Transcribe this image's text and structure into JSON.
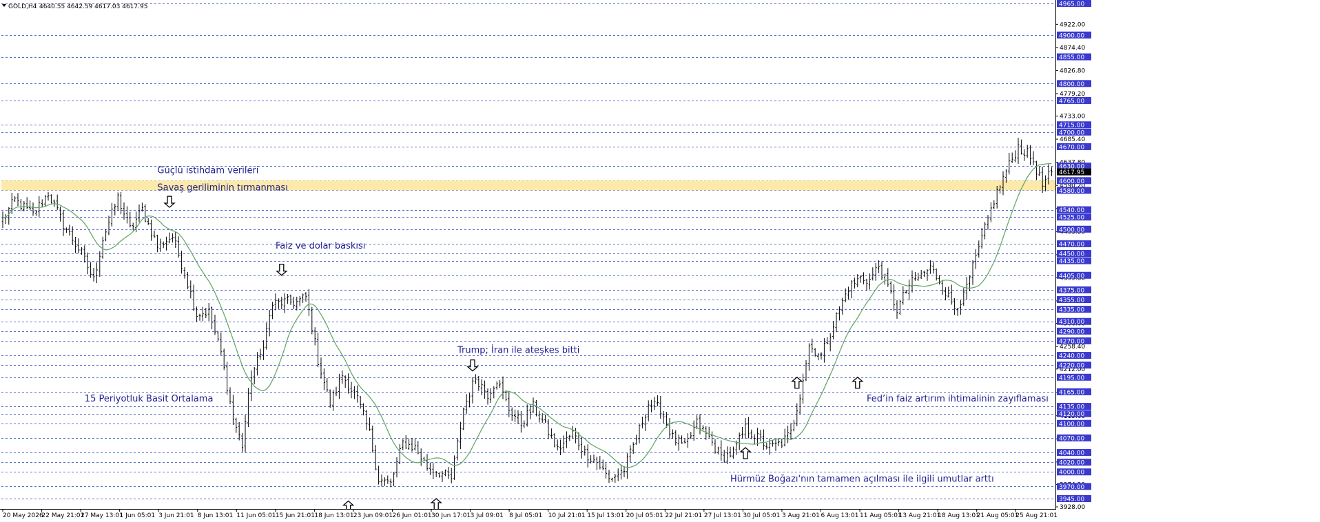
{
  "header": {
    "symbol": "GOLD,H4",
    "ohlc": "4640.55 4642.59 4617.03 4617.95"
  },
  "colors": {
    "background": "#ffffff",
    "grid": "#1f3fbf",
    "candle": "#000000",
    "ma_line": "#6aa86a",
    "highlight_band": "#fde9a8",
    "tag_bg": "#3a3ad0",
    "tag_current": "#000000",
    "annotation_text": "#1f1f8f"
  },
  "icons": {
    "arrow_down": "hollow-arrow-down-icon",
    "arrow_up": "hollow-arrow-up-icon",
    "symbol_menu": "triangle-down-icon"
  },
  "chart_data": {
    "type": "candlestick",
    "indicator": "15 Periyotluk Basit Ortalama",
    "ylim": [
      3928.0,
      4965.0
    ],
    "current_price": 4617.95,
    "highlight_zone": [
      4580.0,
      4600.0
    ],
    "price_axis": {
      "tagged": [
        4965.0,
        4900.0,
        4855.0,
        4800.0,
        4765.0,
        4715.0,
        4700.0,
        4670.0,
        4630.0,
        4600.0,
        4580.0,
        4540.0,
        4525.0,
        4500.0,
        4470.0,
        4450.0,
        4435.0,
        4405.0,
        4375.0,
        4355.0,
        4335.0,
        4310.0,
        4290.0,
        4270.0,
        4240.0,
        4220.0,
        4195.0,
        4165.0,
        4135.0,
        4120.0,
        4100.0,
        4070.0,
        4040.0,
        4020.0,
        4000.0,
        3970.0,
        3945.0
      ],
      "plain": [
        "4922.00",
        "4874.40",
        "4826.80",
        "4779.20",
        "4733.00",
        "4685.40",
        "4637.80",
        "4590.20",
        "4542.60",
        "4495.00",
        "4447.40",
        "4399.80",
        "4352.20",
        "4306.00",
        "4258.40",
        "4212.00",
        "4163.20",
        "4115.60",
        "4068.00",
        "4020.40",
        "3974.20",
        "3928.00"
      ]
    },
    "time_labels": [
      "20 May 2026",
      "22 May 21:01",
      "27 May 13:01",
      "1 Jun 05:01",
      "3 Jun 21:01",
      "8 Jun 13:01",
      "11 Jun 05:01",
      "15 Jun 21:01",
      "18 Jun 13:01",
      "23 Jun 09:01",
      "26 Jun 01:01",
      "30 Jun 17:01",
      "3 Jul 09:01",
      "8 Jul 05:01",
      "10 Jul 21:01",
      "15 Jul 13:01",
      "20 Jul 05:01",
      "22 Jul 21:01",
      "27 Jul 13:01",
      "30 Jul 05:01",
      "3 Aug 21:01",
      "6 Aug 13:01",
      "11 Aug 05:01",
      "13 Aug 21:01",
      "18 Aug 13:01",
      "21 Aug 05:01",
      "25 Aug 21:01"
    ],
    "anchors": [
      [
        0,
        4520
      ],
      [
        4,
        4560
      ],
      [
        10,
        4530
      ],
      [
        15,
        4575
      ],
      [
        20,
        4510
      ],
      [
        26,
        4450
      ],
      [
        30,
        4395
      ],
      [
        33,
        4480
      ],
      [
        38,
        4565
      ],
      [
        42,
        4500
      ],
      [
        46,
        4540
      ],
      [
        51,
        4465
      ],
      [
        56,
        4485
      ],
      [
        60,
        4410
      ],
      [
        64,
        4325
      ],
      [
        68,
        4330
      ],
      [
        72,
        4245
      ],
      [
        76,
        4110
      ],
      [
        79,
        4055
      ],
      [
        82,
        4200
      ],
      [
        85,
        4240
      ],
      [
        89,
        4345
      ],
      [
        93,
        4350
      ],
      [
        97,
        4350
      ],
      [
        100,
        4360
      ],
      [
        102,
        4300
      ],
      [
        104,
        4230
      ],
      [
        108,
        4140
      ],
      [
        112,
        4200
      ],
      [
        117,
        4150
      ],
      [
        121,
        4080
      ],
      [
        124,
        3985
      ],
      [
        128,
        3975
      ],
      [
        132,
        4060
      ],
      [
        136,
        4050
      ],
      [
        140,
        4010
      ],
      [
        144,
        4000
      ],
      [
        148,
        3985
      ],
      [
        152,
        4130
      ],
      [
        156,
        4195
      ],
      [
        160,
        4160
      ],
      [
        163,
        4190
      ],
      [
        167,
        4130
      ],
      [
        171,
        4100
      ],
      [
        175,
        4135
      ],
      [
        179,
        4095
      ],
      [
        183,
        4045
      ],
      [
        188,
        4080
      ],
      [
        192,
        4040
      ],
      [
        196,
        4020
      ],
      [
        200,
        3985
      ],
      [
        205,
        4005
      ],
      [
        209,
        4070
      ],
      [
        213,
        4140
      ],
      [
        217,
        4130
      ],
      [
        221,
        4070
      ],
      [
        225,
        4050
      ],
      [
        229,
        4100
      ],
      [
        233,
        4070
      ],
      [
        237,
        4030
      ],
      [
        241,
        4040
      ],
      [
        245,
        4090
      ],
      [
        249,
        4070
      ],
      [
        253,
        4050
      ],
      [
        257,
        4060
      ],
      [
        260,
        4080
      ],
      [
        263,
        4160
      ],
      [
        266,
        4260
      ],
      [
        270,
        4240
      ],
      [
        275,
        4320
      ],
      [
        279,
        4380
      ],
      [
        283,
        4400
      ],
      [
        286,
        4395
      ],
      [
        289,
        4425
      ],
      [
        292,
        4380
      ],
      [
        295,
        4335
      ],
      [
        299,
        4385
      ],
      [
        302,
        4400
      ],
      [
        306,
        4420
      ],
      [
        309,
        4395
      ],
      [
        312,
        4360
      ],
      [
        314,
        4340
      ],
      [
        317,
        4360
      ],
      [
        320,
        4420
      ],
      [
        323,
        4480
      ],
      [
        327,
        4560
      ],
      [
        331,
        4620
      ],
      [
        335,
        4670
      ],
      [
        338,
        4655
      ],
      [
        340,
        4640
      ],
      [
        343,
        4590
      ],
      [
        346,
        4617.95
      ]
    ],
    "annotations": [
      {
        "text": "Güçlü istihdam verileri",
        "bar": 51,
        "price": 4615,
        "arrow": "none"
      },
      {
        "text": "Savaş geriliminin tırmanması",
        "bar": 51,
        "price": 4580,
        "arrow": "down",
        "arrow_bar": 55,
        "arrow_price": 4545
      },
      {
        "text": "Faiz ve dolar baskısı",
        "bar": 90,
        "price": 4460,
        "arrow": "down",
        "arrow_bar": 92,
        "arrow_price": 4405
      },
      {
        "text": "Trump; İran ile ateşkes bitti",
        "bar": 150,
        "price": 4245,
        "arrow": "down",
        "arrow_bar": 155,
        "arrow_price": 4208
      },
      {
        "text": "15 Periyotluk Basit Ortalama",
        "bar": 27,
        "price": 4145,
        "arrow": "none"
      },
      {
        "text": "Fed’in faiz artırım ihtimalinin zayıflaması",
        "bar": 285,
        "price": 4145,
        "arrow": "none"
      },
      {
        "text": "Hürmüz Boğazı'nın tamamen açılması ile ilgili umutlar arttı",
        "bar": 240,
        "price": 3980,
        "arrow": "none"
      },
      {
        "text": "",
        "bar": 262,
        "price": 4040,
        "arrow": "up",
        "arrow_bar": 245,
        "arrow_price": 4050
      },
      {
        "text": "",
        "bar": 262,
        "price": 4190,
        "arrow": "up",
        "arrow_bar": 262,
        "arrow_price": 4195
      },
      {
        "text": "",
        "bar": 282,
        "price": 4190,
        "arrow": "up",
        "arrow_bar": 282,
        "arrow_price": 4195
      },
      {
        "text": "",
        "bar": 114,
        "price": 3945,
        "arrow": "up",
        "arrow_bar": 114,
        "arrow_price": 3940
      },
      {
        "text": "",
        "bar": 143,
        "price": 3945,
        "arrow": "up",
        "arrow_bar": 143,
        "arrow_price": 3945
      }
    ]
  }
}
